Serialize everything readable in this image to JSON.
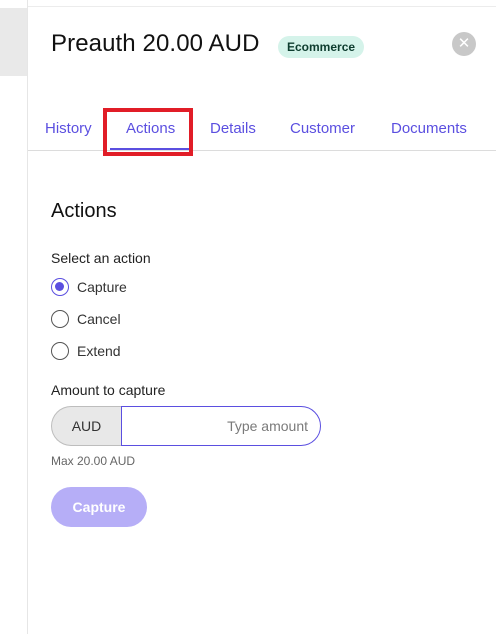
{
  "header": {
    "title": "Preauth 20.00 AUD",
    "badge": "Ecommerce",
    "close_icon": "close-icon"
  },
  "tabs": [
    {
      "label": "History"
    },
    {
      "label": "Actions",
      "active": true
    },
    {
      "label": "Details"
    },
    {
      "label": "Customer"
    },
    {
      "label": "Documents"
    }
  ],
  "actions": {
    "title": "Actions",
    "select_label": "Select an action",
    "options": [
      {
        "label": "Capture",
        "checked": true
      },
      {
        "label": "Cancel",
        "checked": false
      },
      {
        "label": "Extend",
        "checked": false
      }
    ],
    "amount_label": "Amount to capture",
    "currency": "AUD",
    "amount_value": "",
    "amount_placeholder": "Type amount",
    "max_hint": "Max 20.00 AUD",
    "submit_label": "Capture"
  },
  "colors": {
    "accent": "#5b4fe0",
    "badge_bg": "#d5f3ea",
    "disabled_button": "#b6aef7",
    "highlight": "#e11d27"
  }
}
